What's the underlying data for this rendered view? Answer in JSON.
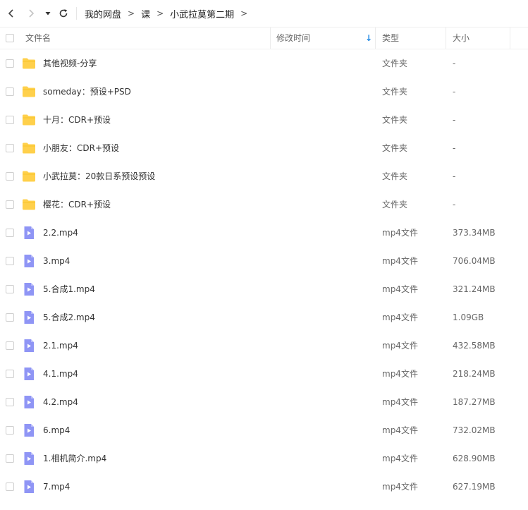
{
  "nav": {
    "back_icon": "chevron-left-icon",
    "forward_icon": "chevron-right-icon",
    "history_icon": "caret-down-icon",
    "refresh_icon": "refresh-icon"
  },
  "breadcrumb": {
    "items": [
      "我的网盘",
      "课",
      "小武拉莫第二期"
    ],
    "separator": ">"
  },
  "columns": {
    "name": "文件名",
    "modified": "修改时间",
    "type": "类型",
    "size": "大小",
    "sort_indicator": "↓"
  },
  "colors": {
    "folder": "#ffd04b",
    "video": "#8f95f5",
    "sort_arrow": "#1e88e5"
  },
  "files": [
    {
      "name": "其他视频-分享",
      "type": "文件夹",
      "size": "-",
      "icon": "folder-icon"
    },
    {
      "name": "someday：预设+PSD",
      "type": "文件夹",
      "size": "-",
      "icon": "folder-icon"
    },
    {
      "name": "十月：CDR+预设",
      "type": "文件夹",
      "size": "-",
      "icon": "folder-icon"
    },
    {
      "name": "小朋友：CDR+预设",
      "type": "文件夹",
      "size": "-",
      "icon": "folder-icon"
    },
    {
      "name": "小武拉莫：20款日系预设预设",
      "type": "文件夹",
      "size": "-",
      "icon": "folder-icon"
    },
    {
      "name": "樱花：CDR+预设",
      "type": "文件夹",
      "size": "-",
      "icon": "folder-icon"
    },
    {
      "name": "2.2.mp4",
      "type": "mp4文件",
      "size": "373.34MB",
      "icon": "video-file-icon"
    },
    {
      "name": "3.mp4",
      "type": "mp4文件",
      "size": "706.04MB",
      "icon": "video-file-icon"
    },
    {
      "name": "5.合成1.mp4",
      "type": "mp4文件",
      "size": "321.24MB",
      "icon": "video-file-icon"
    },
    {
      "name": "5.合成2.mp4",
      "type": "mp4文件",
      "size": "1.09GB",
      "icon": "video-file-icon"
    },
    {
      "name": "2.1.mp4",
      "type": "mp4文件",
      "size": "432.58MB",
      "icon": "video-file-icon"
    },
    {
      "name": "4.1.mp4",
      "type": "mp4文件",
      "size": "218.24MB",
      "icon": "video-file-icon"
    },
    {
      "name": "4.2.mp4",
      "type": "mp4文件",
      "size": "187.27MB",
      "icon": "video-file-icon"
    },
    {
      "name": "6.mp4",
      "type": "mp4文件",
      "size": "732.02MB",
      "icon": "video-file-icon"
    },
    {
      "name": "1.相机简介.mp4",
      "type": "mp4文件",
      "size": "628.90MB",
      "icon": "video-file-icon"
    },
    {
      "name": "7.mp4",
      "type": "mp4文件",
      "size": "627.19MB",
      "icon": "video-file-icon"
    }
  ]
}
